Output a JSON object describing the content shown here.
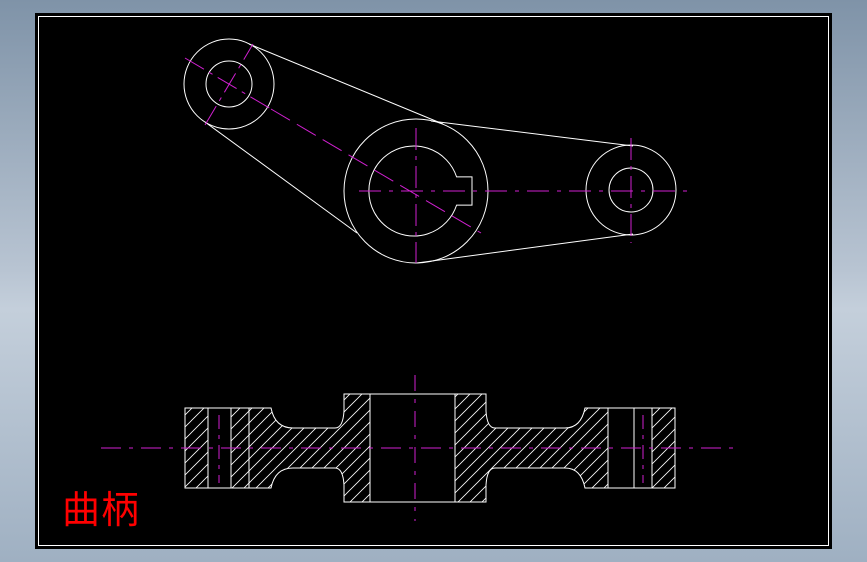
{
  "drawing": {
    "title": "曲柄",
    "colors": {
      "background": "#000000",
      "outline": "#ffffff",
      "centerline": "#d020d0",
      "title": "#ff0000",
      "frame": "#ffffff"
    }
  }
}
